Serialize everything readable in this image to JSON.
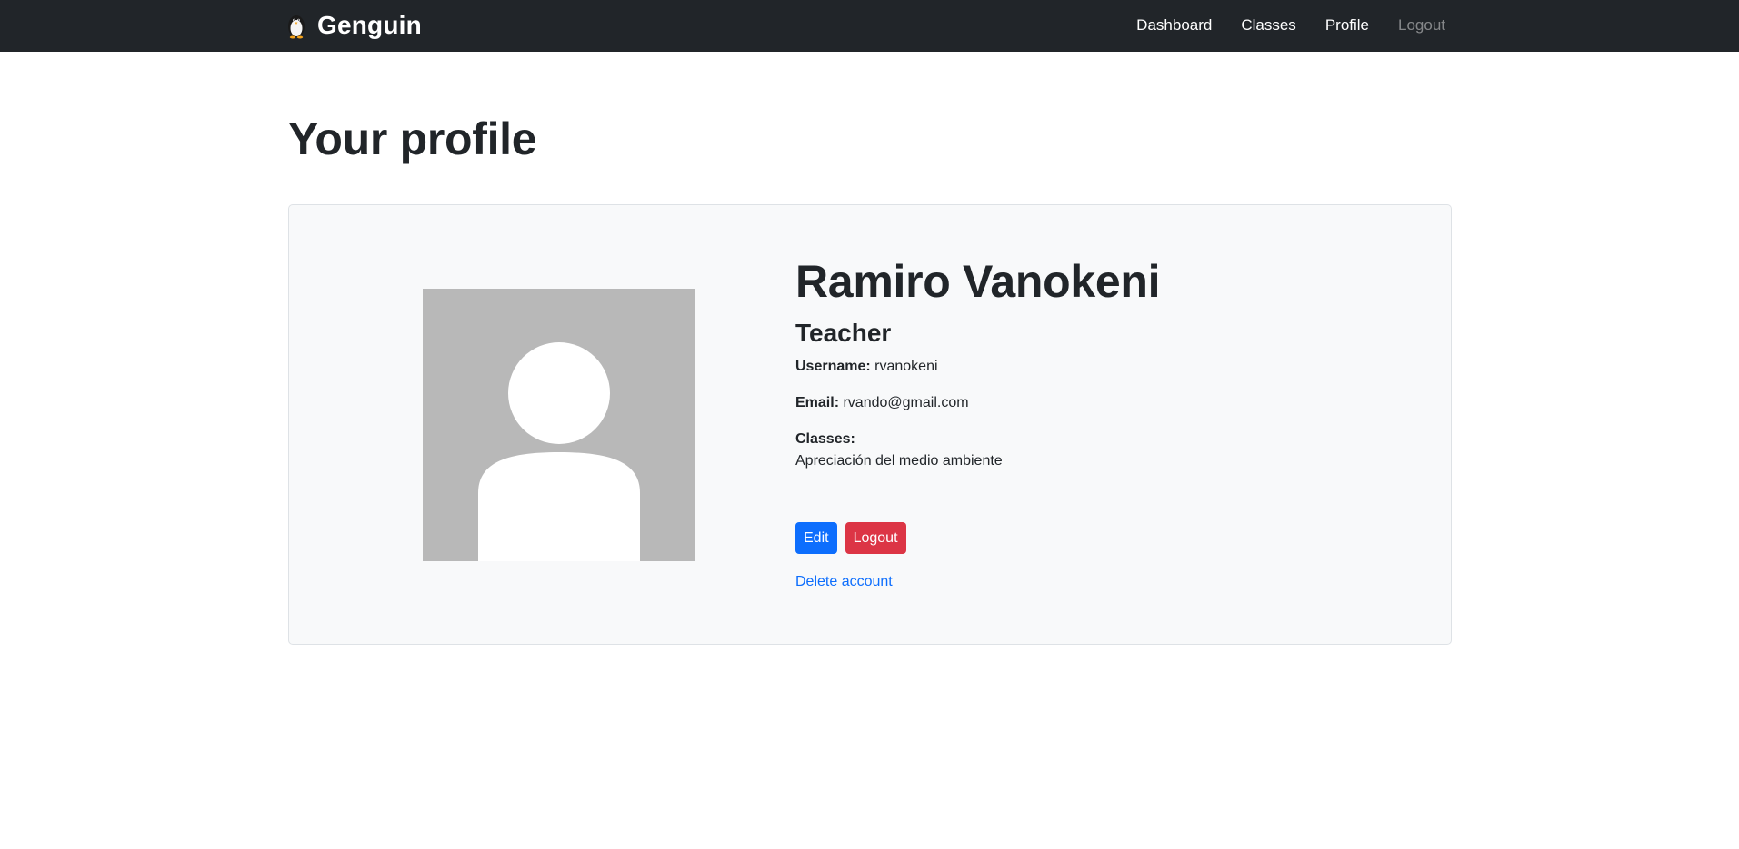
{
  "app": {
    "brand": "Genguin",
    "logo_icon": "penguin-icon"
  },
  "nav": {
    "items": [
      {
        "label": "Dashboard",
        "disabled": false
      },
      {
        "label": "Classes",
        "disabled": false
      },
      {
        "label": "Profile",
        "disabled": false
      },
      {
        "label": "Logout",
        "disabled": true
      }
    ]
  },
  "page": {
    "title": "Your profile"
  },
  "profile": {
    "avatar_icon": "user-placeholder-icon",
    "name": "Ramiro Vanokeni",
    "role": "Teacher",
    "username_label": "Username:",
    "username": "rvanokeni",
    "email_label": "Email:",
    "email": "rvando@gmail.com",
    "classes_label": "Classes:",
    "classes": [
      "Apreciación del medio ambiente"
    ]
  },
  "actions": {
    "edit_label": "Edit",
    "logout_label": "Logout",
    "delete_label": "Delete account"
  },
  "colors": {
    "navbar": "#212529",
    "primary": "#0d6efd",
    "danger": "#dc3545",
    "card_bg": "#f8f9fa",
    "avatar_bg": "#b8b8b8"
  }
}
